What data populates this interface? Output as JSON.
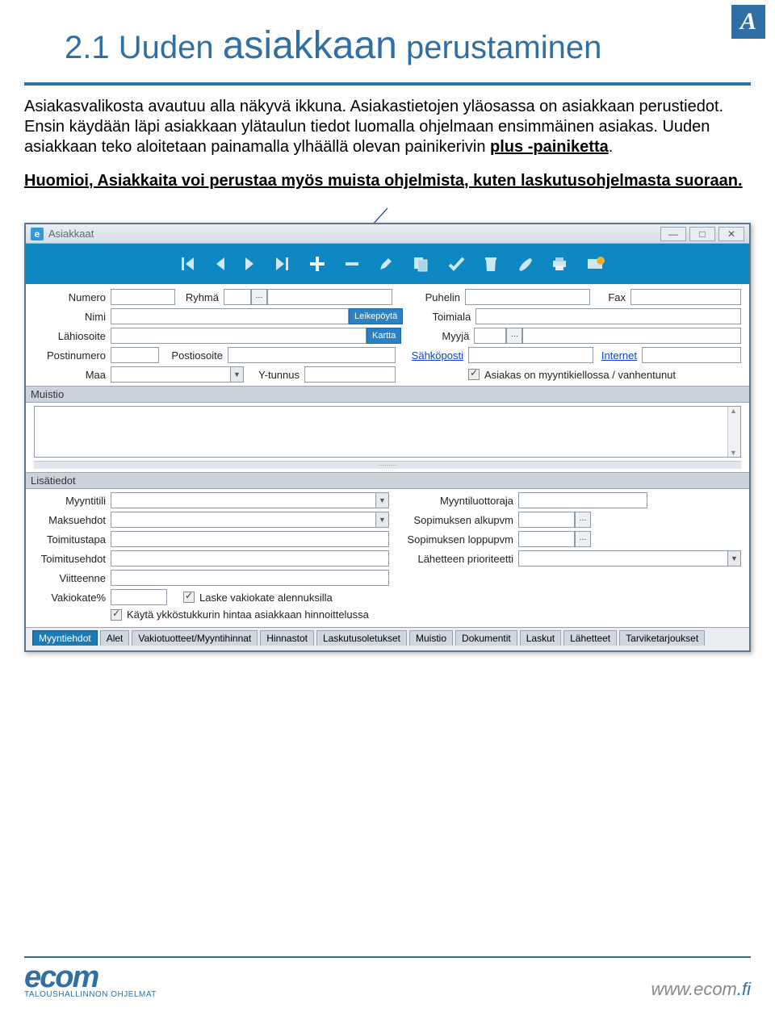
{
  "corner_badge": "A",
  "title_prefix": "2.1 Uuden ",
  "title_big": "asiakkaan",
  "title_suffix": " perustaminen",
  "paragraph_pre": "Asiakasvalikosta avautuu alla näkyvä ikkuna. Asiakastietojen yläosassa on asiakkaan perustiedot. Ensin käydään läpi asiakkaan ylätaulun tiedot luomalla ohjelmaan ensimmäinen asiakas. Uuden asiakkaan teko aloitetaan painamalla ylhäällä olevan painikerivin ",
  "paragraph_link": "plus -painiketta",
  "notice": "Huomioi, Asiakkaita voi perustaa myös muista ohjelmista, kuten laskutusohjelmasta suoraan.",
  "window": {
    "title": "Asiakkaat",
    "labels": {
      "numero": "Numero",
      "ryhma": "Ryhmä",
      "puhelin": "Puhelin",
      "fax": "Fax",
      "nimi": "Nimi",
      "leikepoyta": "Leikepöytä",
      "toimiala": "Toimiala",
      "lahiosoite": "Lähiosoite",
      "kartta": "Kartta",
      "myyja": "Myyjä",
      "postinumero": "Postinumero",
      "postiosoite": "Postiosoite",
      "sahkoposti": "Sähköposti",
      "internet": "Internet",
      "maa": "Maa",
      "ytunnus": "Y-tunnus",
      "kielto": "Asiakas on myyntikiellossa / vanhentunut",
      "muistio": "Muistio",
      "lisatiedot": "Lisätiedot",
      "myyntitili": "Myyntitili",
      "luottoraja": "Myyntiluottoraja",
      "maksuehdot": "Maksuehdot",
      "sop_alku": "Sopimuksen alkupvm",
      "toimitustapa": "Toimitustapa",
      "sop_loppu": "Sopimuksen loppupvm",
      "toimitusehdot": "Toimitusehdot",
      "prioriteetti": "Lähetteen prioriteetti",
      "viitteenne": "Viitteenne",
      "vakiokate": "Vakiokate%",
      "laske_vakiokate": "Laske vakiokate alennuksilla",
      "kayta_ykkos": "Käytä ykköstukkurin hintaa asiakkaan hinnoittelussa"
    },
    "tabs": [
      "Myyntiehdot",
      "Alet",
      "Vakiotuotteet/Myyntihinnat",
      "Hinnastot",
      "Laskutusoletukset",
      "Muistio",
      "Dokumentit",
      "Laskut",
      "Lähetteet",
      "Tarviketarjoukset"
    ]
  },
  "footer": {
    "logo_text": "ecom",
    "logo_sub": "TALOUSHALLINNON OHJELMAT",
    "url_main": "www.ecom",
    "url_tld": ".fi"
  }
}
